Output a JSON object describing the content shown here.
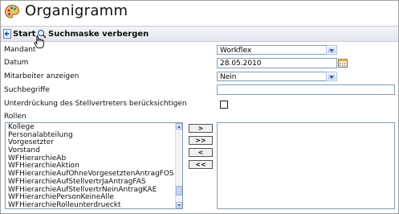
{
  "window": {
    "title": "Organigramm",
    "title_icon": "palette-icon"
  },
  "toolbar": {
    "start_label": "Start",
    "search_mask_label": "Suchmaske verbergen",
    "start_icon": "back-arrow-icon",
    "search_icon": "magnifier-icon"
  },
  "form": {
    "mandant": {
      "label": "Mandant",
      "value": "Workflex"
    },
    "datum": {
      "label": "Datum",
      "value": "28.05.2010"
    },
    "mitarbeiter": {
      "label": "Mitarbeiter anzeigen",
      "value": "Nein"
    },
    "suchbegriffe": {
      "label": "Suchbegriffe",
      "value": ""
    },
    "unterdrueckung": {
      "label": "Unterdrückung des Stellvertreters berücksichtigen",
      "checked": false
    },
    "rollen": {
      "label": "Rollen",
      "available": [
        "Kollege",
        "Personalabteilung",
        "Vorgesetzter",
        "Vorstand",
        "WFHierarchieAb",
        "WFHierarchieAktion",
        "WFHierarchieAufOhneVorgesetztenAntragFOS",
        "WFHierarchieAufStellvertrJaAntragFAS",
        "WFHierarchieAufStellvertrNeinAntragKAE",
        "WFHierarchiePersonKeineAlle",
        "WFHierarchieRolleunterdrueckt"
      ],
      "selected": [],
      "buttons": {
        "add": ">",
        "add_all": ">>",
        "remove": "<",
        "remove_all": "<<"
      }
    }
  }
}
